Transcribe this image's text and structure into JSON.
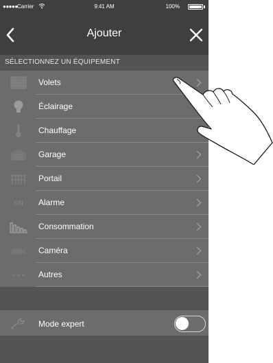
{
  "status_bar": {
    "signal_dots": "●●●●●",
    "carrier": "Carrier",
    "wifi_icon": "wifi-icon",
    "time": "9:41 AM",
    "battery_percent": "100%",
    "battery_icon": "battery-icon"
  },
  "nav": {
    "title": "Ajouter",
    "back_icon": "chevron-left-icon",
    "close_icon": "close-icon"
  },
  "section_header": "SÉLECTIONNEZ UN ÉQUIPEMENT",
  "items": [
    {
      "label": "Volets",
      "icon": "shutter-icon",
      "chevron": true
    },
    {
      "label": "Éclairage",
      "icon": "lightbulb-icon",
      "chevron": false
    },
    {
      "label": "Chauffage",
      "icon": "thermometer-icon",
      "chevron": false
    },
    {
      "label": "Garage",
      "icon": "garage-icon",
      "chevron": true
    },
    {
      "label": "Portail",
      "icon": "gate-icon",
      "chevron": true
    },
    {
      "label": "Alarme",
      "icon": "alarm-icon",
      "icon_text": "ON",
      "chevron": true
    },
    {
      "label": "Consommation",
      "icon": "consumption-icon",
      "chevron": true
    },
    {
      "label": "Caméra",
      "icon": "camera-icon",
      "chevron": true
    },
    {
      "label": "Autres",
      "icon": "other-icon",
      "chevron": true
    }
  ],
  "expert": {
    "label": "Mode expert",
    "icon": "wrench-icon",
    "toggle_on": false
  },
  "colors": {
    "navbar": "#3f3f3f",
    "background": "#545454",
    "row": "#6c6c6c",
    "divider": "#8a8a8a",
    "icon_muted": "#828282",
    "text": "#ffffff"
  },
  "overlay": {
    "icon": "pointing-hand-icon"
  }
}
